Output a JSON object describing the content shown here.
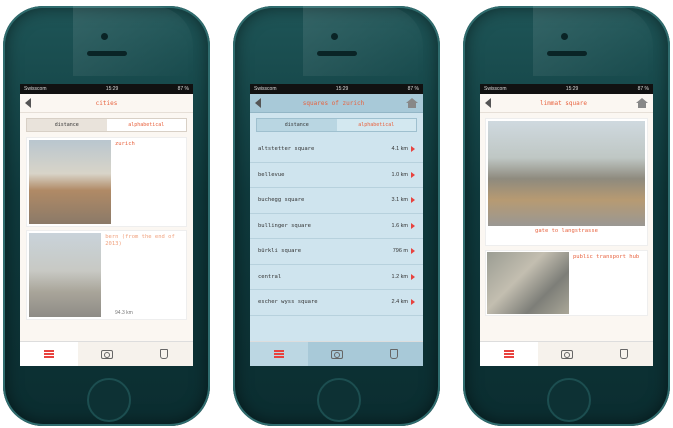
{
  "status": {
    "carrier": "Swisscom",
    "time": "15:29",
    "battery": "87 %"
  },
  "screen1": {
    "title": "cities",
    "segments": [
      "distance",
      "alphabetical"
    ],
    "items": [
      {
        "name": "zurich",
        "distance": ""
      },
      {
        "name": "bern (from the end of 2013)",
        "distance": "94.3 km"
      }
    ]
  },
  "screen2": {
    "title": "squares of zurich",
    "segments": [
      "distance",
      "alphabetical"
    ],
    "rows": [
      {
        "name": "altstetter square",
        "distance": "4.1 km"
      },
      {
        "name": "bellevue",
        "distance": "1.0 km"
      },
      {
        "name": "buchegg square",
        "distance": "3.1 km"
      },
      {
        "name": "bullinger square",
        "distance": "1.6 km"
      },
      {
        "name": "bürkli square",
        "distance": "796 m"
      },
      {
        "name": "central",
        "distance": "1.2 km"
      },
      {
        "name": "escher wyss square",
        "distance": "2.4 km"
      }
    ]
  },
  "screen3": {
    "title": "limmat square",
    "hero_caption": "gate to langstrasse",
    "item_text": "public transport hub"
  },
  "icons": [
    "back-icon",
    "home-icon",
    "list-icon",
    "camera-icon",
    "map-pin-icon"
  ],
  "colors": {
    "accent": "#e8623e",
    "list_bg": "#cfe4ee",
    "phone_body": "#0f3a3d"
  }
}
